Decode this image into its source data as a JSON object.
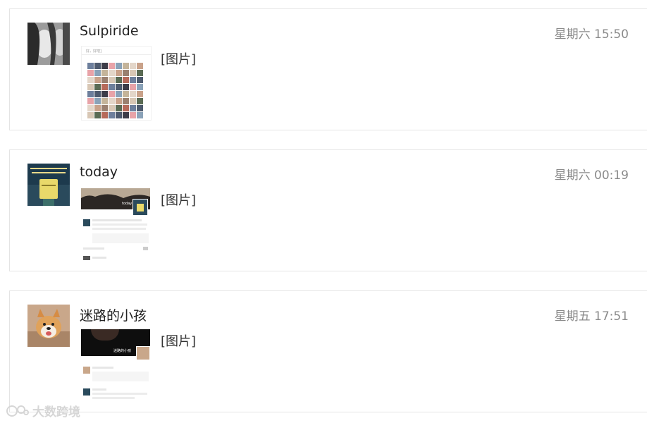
{
  "messages": [
    {
      "nickname": "Sulpiride",
      "timestamp": "星期六 15:50",
      "content_label": "[图片]",
      "avatar_icon": "person-profile-avatar",
      "thumb_title": "好，好吧]"
    },
    {
      "nickname": "today",
      "timestamp": "星期六 00:19",
      "content_label": "[图片]",
      "avatar_icon": "book-cover-avatar",
      "thumb_banner": "today"
    },
    {
      "nickname": "迷路的小孩",
      "timestamp": "星期五 17:51",
      "content_label": "[图片]",
      "avatar_icon": "dog-avatar",
      "thumb_banner": "迷路的小孩"
    }
  ],
  "watermark": {
    "text": "大数跨境"
  },
  "colors": {
    "card_border": "#e4e4e4",
    "timestamp": "#8a8a8a",
    "nickname": "#222222"
  }
}
